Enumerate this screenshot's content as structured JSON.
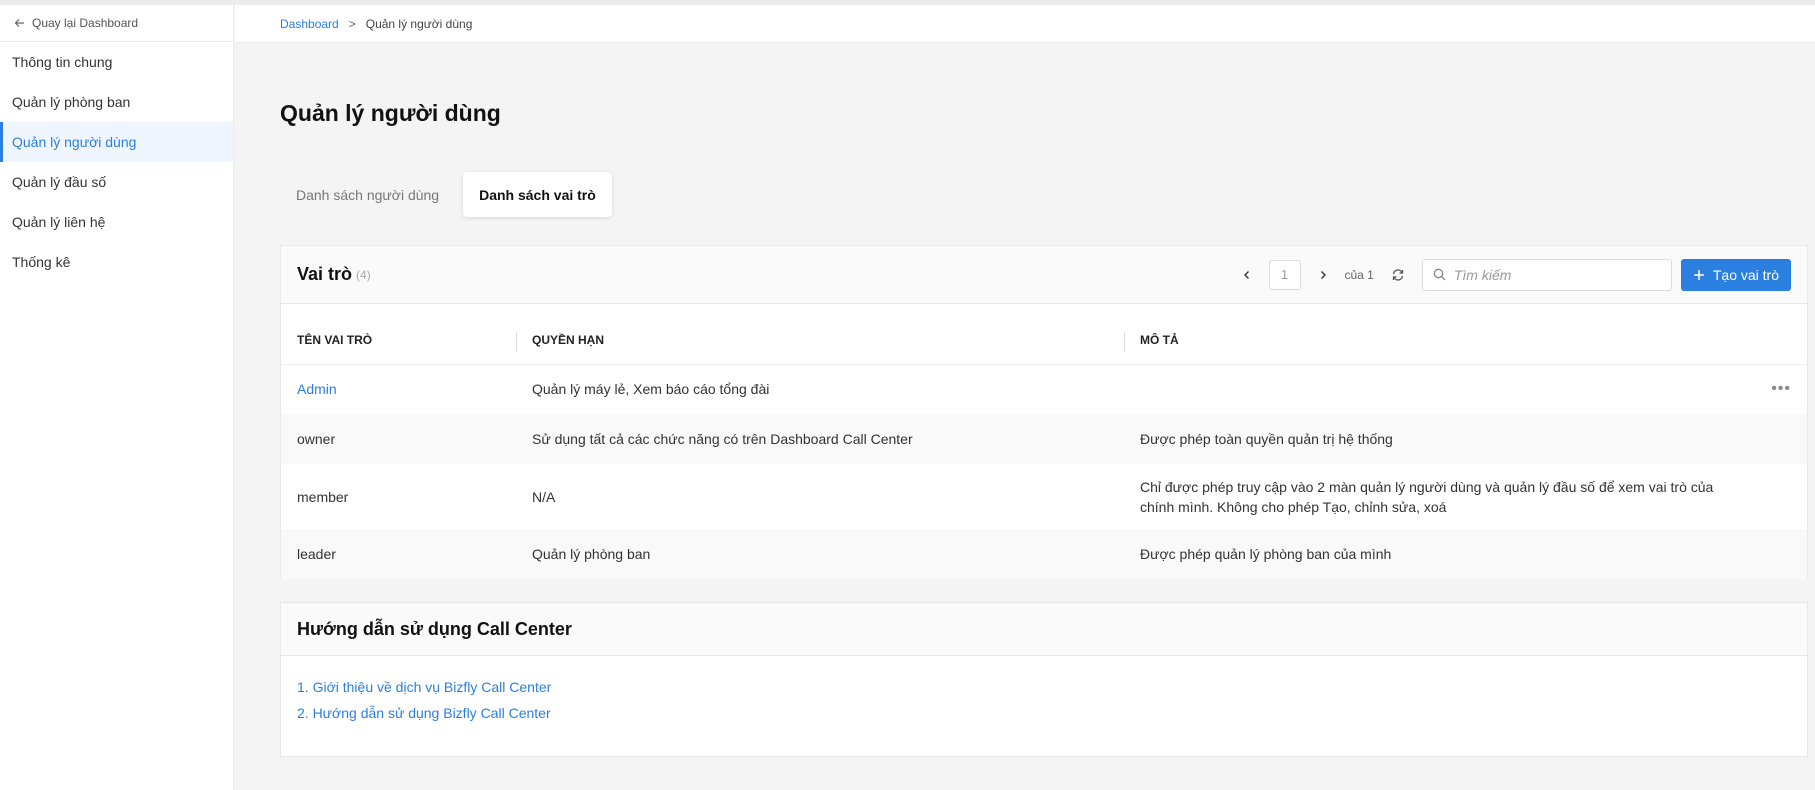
{
  "sidebar": {
    "back_label": "Quay lại Dashboard",
    "items": [
      {
        "label": "Thông tin chung"
      },
      {
        "label": "Quản lý phòng ban"
      },
      {
        "label": "Quản lý người dùng",
        "active": true
      },
      {
        "label": "Quản lý đầu số"
      },
      {
        "label": "Quản lý liên hệ"
      },
      {
        "label": "Thống kê"
      }
    ]
  },
  "breadcrumb": {
    "root": "Dashboard",
    "separator": ">",
    "current": "Quản lý người dùng"
  },
  "page": {
    "title": "Quản lý người dùng"
  },
  "tabs": [
    {
      "label": "Danh sách người dùng",
      "active": false
    },
    {
      "label": "Danh sách vai trò",
      "active": true
    }
  ],
  "roles_card": {
    "title": "Vai trò",
    "count": "(4)",
    "pagination": {
      "current_page": "1",
      "of_label": "của 1"
    },
    "search_placeholder": "Tìm kiếm",
    "create_button": "Tạo vai trò",
    "columns": [
      "TÊN VAI TRÒ",
      "QUYỀN HẠN",
      "MÔ TẢ"
    ],
    "rows": [
      {
        "name": "Admin",
        "permissions": "Quản lý máy lẻ, Xem báo cáo tổng đài",
        "description": ""
      },
      {
        "name": "owner",
        "permissions": "Sử dụng tất cả các chức năng có trên Dashboard Call Center",
        "description": "Được phép toàn quyền quản trị hệ thống"
      },
      {
        "name": "member",
        "permissions": "N/A",
        "description": "Chỉ được phép truy cập vào 2 màn quản lý người dùng và quản lý đầu số để xem vai trò của chính mình. Không cho phép Tạo, chỉnh sửa, xoá"
      },
      {
        "name": "leader",
        "permissions": "Quản lý phòng ban",
        "description": "Được phép quản lý phòng ban của mình"
      }
    ],
    "row_menu_label": "•••"
  },
  "guide_card": {
    "title": "Hướng dẫn sử dụng Call Center",
    "links": [
      "1. Giới thiệu về dịch vụ Bizfly Call Center",
      "2. Hướng dẫn sử dụng Bizfly Call Center"
    ]
  },
  "colors": {
    "accent": "#2b7fe0",
    "background": "#f4f4f4"
  }
}
